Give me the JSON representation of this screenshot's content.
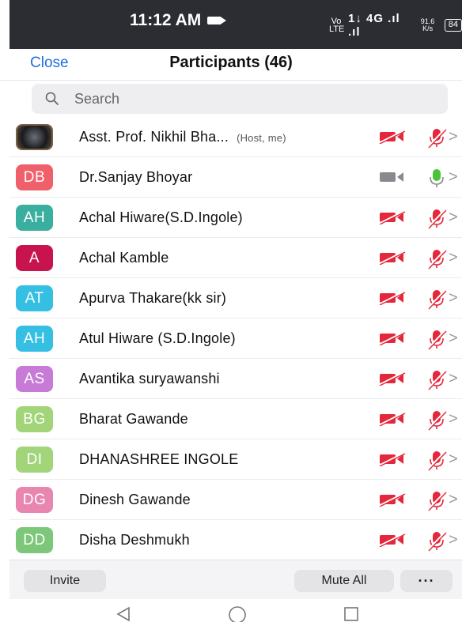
{
  "status_bar": {
    "time": "11:12 AM",
    "network": "Vo LTE",
    "signal": "1↓ 4G .ıl .ıl",
    "speed": "91.6 K/s",
    "battery": "84"
  },
  "header": {
    "close_label": "Close",
    "title": "Participants (46)"
  },
  "search": {
    "placeholder": "Search"
  },
  "colors": {
    "accent": "#1d6fe0",
    "muted_red": "#e5273b",
    "unmuted_green": "#4cc23a"
  },
  "participants": [
    {
      "initials": "",
      "name": "Asst. Prof. Nikhil Bha...",
      "tag": "(Host, me)",
      "color": "#3b3e44",
      "video": "off",
      "audio": "muted"
    },
    {
      "initials": "DB",
      "name": "Dr.Sanjay Bhoyar",
      "tag": "",
      "color": "#f0606a",
      "video": "on",
      "audio": "unmuted"
    },
    {
      "initials": "AH",
      "name": "Achal Hiware(S.D.Ingole)",
      "tag": "",
      "color": "#3aaf9f",
      "video": "off",
      "audio": "muted"
    },
    {
      "initials": "A",
      "name": "Achal Kamble",
      "tag": "",
      "color": "#c8134f",
      "video": "off",
      "audio": "muted"
    },
    {
      "initials": "AT",
      "name": "Apurva Thakare(kk sir)",
      "tag": "",
      "color": "#35c0e3",
      "video": "off",
      "audio": "muted"
    },
    {
      "initials": "AH",
      "name": "Atul Hiware (S.D.Ingole)",
      "tag": "",
      "color": "#35c0e3",
      "video": "off",
      "audio": "muted"
    },
    {
      "initials": "AS",
      "name": "Avantika suryawanshi",
      "tag": "",
      "color": "#c77ad6",
      "video": "off",
      "audio": "muted"
    },
    {
      "initials": "BG",
      "name": "Bharat Gawande",
      "tag": "",
      "color": "#a2d57a",
      "video": "off",
      "audio": "muted"
    },
    {
      "initials": "DI",
      "name": "DHANASHREE INGOLE",
      "tag": "",
      "color": "#a2d57a",
      "video": "off",
      "audio": "muted"
    },
    {
      "initials": "DG",
      "name": "Dinesh Gawande",
      "tag": "",
      "color": "#e886b0",
      "video": "off",
      "audio": "muted"
    },
    {
      "initials": "DD",
      "name": "Disha Deshmukh",
      "tag": "",
      "color": "#7cc77a",
      "video": "off",
      "audio": "muted"
    }
  ],
  "footer": {
    "invite_label": "Invite",
    "mute_all_label": "Mute All",
    "more_label": "···"
  }
}
